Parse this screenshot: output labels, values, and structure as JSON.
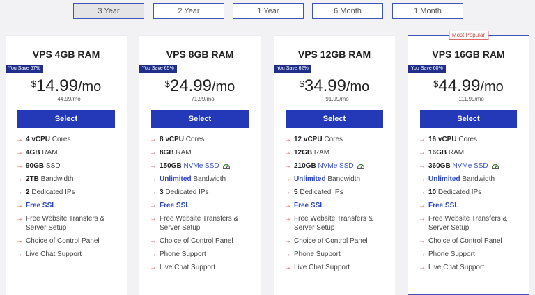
{
  "terms": [
    {
      "label": "3 Year",
      "active": true
    },
    {
      "label": "2 Year",
      "active": false
    },
    {
      "label": "1 Year",
      "active": false
    },
    {
      "label": "6 Month",
      "active": false
    },
    {
      "label": "1 Month",
      "active": false
    }
  ],
  "plans": [
    {
      "name": "VPS 4GB RAM",
      "save": "You Save 67%",
      "currency": "$",
      "price": "14.99",
      "per": "/mo",
      "old_price": "44.99/mo",
      "select": "Select",
      "popular": "",
      "features": [
        {
          "strong": "4 vCPU",
          "rest": " Cores"
        },
        {
          "strong": "4GB",
          "rest": " RAM"
        },
        {
          "strong": "90GB",
          "rest": " SSD"
        },
        {
          "strong": "2TB",
          "rest": " Bandwidth"
        },
        {
          "strong": "2",
          "rest": " Dedicated IPs"
        },
        {
          "link_bold": "Free SSL"
        },
        {
          "rest": "Free Website Transfers & Server Setup"
        },
        {
          "rest": "Choice of Control Panel"
        },
        {
          "rest": "Live Chat Support"
        }
      ]
    },
    {
      "name": "VPS 8GB RAM",
      "save": "You Save 65%",
      "currency": "$",
      "price": "24.99",
      "per": "/mo",
      "old_price": "71.99/mo",
      "select": "Select",
      "popular": "",
      "features": [
        {
          "strong": "8 vCPU",
          "rest": " Cores"
        },
        {
          "strong": "8GB",
          "rest": " RAM"
        },
        {
          "strong": "150GB",
          "link": " NVMe SSD",
          "icon": "speed-gauge-icon"
        },
        {
          "link_bold": "Unlimited",
          "rest": " Bandwidth"
        },
        {
          "strong": "3",
          "rest": " Dedicated IPs"
        },
        {
          "link_bold": "Free SSL"
        },
        {
          "rest": "Free Website Transfers & Server Setup"
        },
        {
          "rest": "Choice of Control Panel"
        },
        {
          "rest": "Phone Support"
        },
        {
          "rest": "Live Chat Support"
        }
      ]
    },
    {
      "name": "VPS 12GB RAM",
      "save": "You Save 62%",
      "currency": "$",
      "price": "34.99",
      "per": "/mo",
      "old_price": "91.99/mo",
      "select": "Select",
      "popular": "",
      "features": [
        {
          "strong": "12 vCPU",
          "rest": " Cores"
        },
        {
          "strong": "12GB",
          "rest": " RAM"
        },
        {
          "strong": "210GB",
          "link": " NVMe SSD",
          "icon": "speed-gauge-icon"
        },
        {
          "link_bold": "Unlimited",
          "rest": " Bandwidth"
        },
        {
          "strong": "5",
          "rest": " Dedicated IPs"
        },
        {
          "link_bold": "Free SSL"
        },
        {
          "rest": "Free Website Transfers & Server Setup"
        },
        {
          "rest": "Choice of Control Panel"
        },
        {
          "rest": "Phone Support"
        },
        {
          "rest": "Live Chat Support"
        }
      ]
    },
    {
      "name": "VPS 16GB RAM",
      "save": "You Save 60%",
      "currency": "$",
      "price": "44.99",
      "per": "/mo",
      "old_price": "111.99/mo",
      "select": "Select",
      "popular": "Most Popular",
      "features": [
        {
          "strong": "16 vCPU",
          "rest": " Cores"
        },
        {
          "strong": "16GB",
          "rest": " RAM"
        },
        {
          "strong": "360GB",
          "link": " NVMe SSD",
          "icon": "speed-gauge-icon"
        },
        {
          "link_bold": "Unlimited",
          "rest": " Bandwidth"
        },
        {
          "strong": "10",
          "rest": " Dedicated IPs"
        },
        {
          "link_bold": "Free SSL"
        },
        {
          "rest": "Free Website Transfers & Server Setup"
        },
        {
          "rest": "Choice of Control Panel"
        },
        {
          "rest": "Phone Support"
        },
        {
          "rest": "Live Chat Support"
        }
      ]
    }
  ],
  "colors": {
    "accent": "#2339b8",
    "arrow": "#d65050",
    "badge": "#1f2f8a",
    "popular_border": "#3d56b8"
  }
}
